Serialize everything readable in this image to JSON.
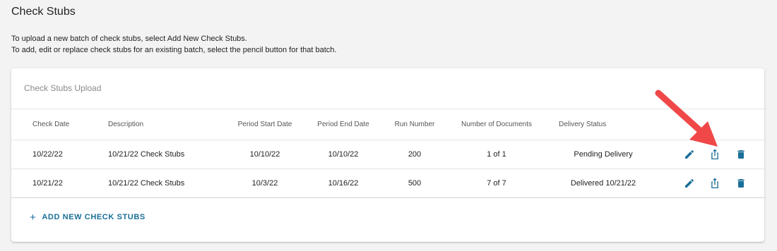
{
  "page": {
    "title": "Check Stubs",
    "instruction_line1": "To upload a new batch of check stubs, select Add New Check Stubs.",
    "instruction_line2": "To add, edit or replace check stubs for an existing batch, select the pencil button for that batch."
  },
  "card": {
    "title": "Check Stubs Upload",
    "add_button_label": "ADD NEW CHECK STUBS",
    "add_button_icon": "plus-icon"
  },
  "table": {
    "headers": {
      "check_date": "Check Date",
      "description": "Description",
      "period_start": "Period Start Date",
      "period_end": "Period End Date",
      "run_number": "Run Number",
      "documents": "Number of Documents",
      "status": "Delivery Status"
    },
    "rows": [
      {
        "check_date": "10/22/22",
        "description": "10/21/22 Check Stubs",
        "period_start": "10/10/22",
        "period_end": "10/10/22",
        "run_number": "200",
        "documents": "1 of 1",
        "status": "Pending Delivery"
      },
      {
        "check_date": "10/21/22",
        "description": "10/21/22 Check Stubs",
        "period_start": "10/3/22",
        "period_end": "10/16/22",
        "run_number": "500",
        "documents": "7 of 7",
        "status": "Delivered 10/21/22"
      }
    ],
    "row_actions": [
      "pencil-icon",
      "share-icon",
      "trash-icon"
    ]
  },
  "colors": {
    "accent": "#1a6f98",
    "background": "#f3f3f3",
    "card": "#ffffff",
    "annotation_arrow": "#f04848"
  }
}
